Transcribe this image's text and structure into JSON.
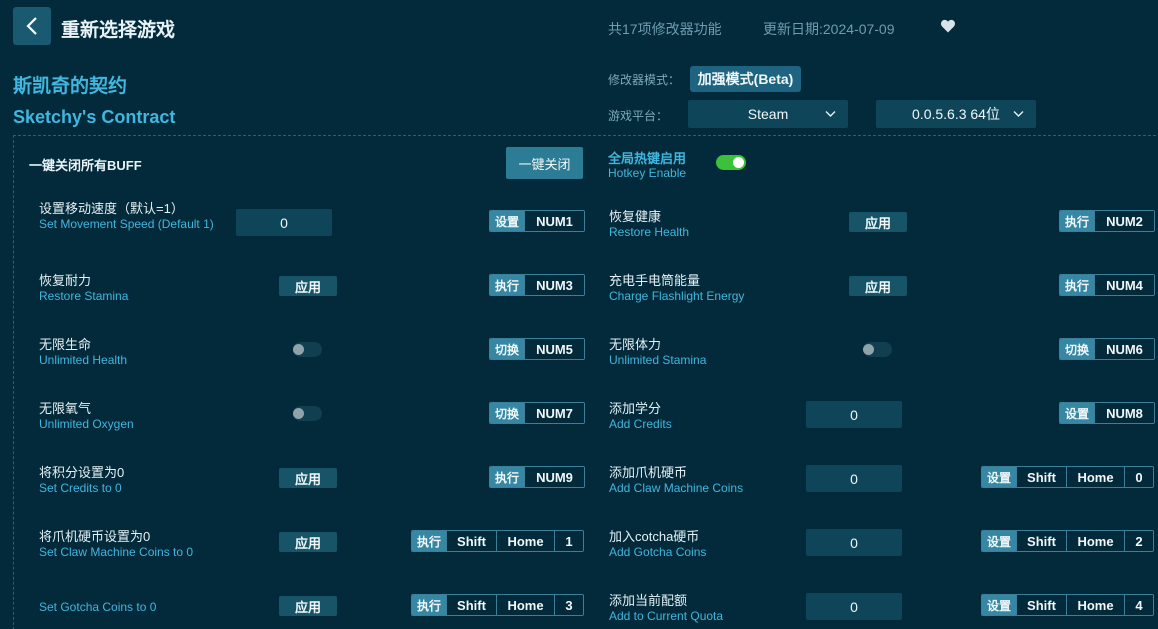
{
  "header": {
    "page_title": "重新选择游戏",
    "feature_count": "共17项修改器功能",
    "update_date": "更新日期:2024-07-09"
  },
  "game": {
    "name_cn": "斯凯奇的契约",
    "name_en": "Sketchy's Contract"
  },
  "mode": {
    "label": "修改器模式：",
    "value": "加强模式(Beta)"
  },
  "platform": {
    "label": "游戏平台：",
    "value": "Steam",
    "version": "0.0.5.6.3 64位"
  },
  "buff": {
    "label": "一键关闭所有BUFF",
    "close_all": "一键关闭"
  },
  "hotkey": {
    "label_cn": "全局热键启用",
    "label_en": "Hotkey Enable",
    "enabled": true
  },
  "options": [
    {
      "cn": "设置移动速度（默认=1）",
      "en": "Set Movement Speed (Default 1)",
      "value": "0",
      "action": "设置",
      "keys": [
        "NUM1"
      ]
    },
    {
      "cn": "恢复健康",
      "en": "Restore Health",
      "button": "应用",
      "action": "执行",
      "keys": [
        "NUM2"
      ]
    },
    {
      "cn": "恢复耐力",
      "en": "Restore Stamina",
      "button": "应用",
      "action": "执行",
      "keys": [
        "NUM3"
      ]
    },
    {
      "cn": "充电手电筒能量",
      "en": "Charge Flashlight Energy",
      "button": "应用",
      "action": "执行",
      "keys": [
        "NUM4"
      ]
    },
    {
      "cn": "无限生命",
      "en": "Unlimited Health",
      "toggle": false,
      "action": "切换",
      "keys": [
        "NUM5"
      ]
    },
    {
      "cn": "无限体力",
      "en": "Unlimited Stamina",
      "toggle": false,
      "action": "切换",
      "keys": [
        "NUM6"
      ]
    },
    {
      "cn": "无限氧气",
      "en": "Unlimited Oxygen",
      "toggle": false,
      "action": "切换",
      "keys": [
        "NUM7"
      ]
    },
    {
      "cn": "添加学分",
      "en": "Add Credits",
      "value": "0",
      "action": "设置",
      "keys": [
        "NUM8"
      ]
    },
    {
      "cn": "将积分设置为0",
      "en": "Set Credits to 0",
      "button": "应用",
      "action": "执行",
      "keys": [
        "NUM9"
      ]
    },
    {
      "cn": "添加爪机硬币",
      "en": "Add Claw Machine Coins",
      "value": "0",
      "action": "设置",
      "keys": [
        "Shift",
        "Home",
        "0"
      ]
    },
    {
      "cn": "将爪机硬币设置为0",
      "en": "Set Claw Machine Coins to 0",
      "button": "应用",
      "action": "执行",
      "keys": [
        "Shift",
        "Home",
        "1"
      ]
    },
    {
      "cn": "加入cotcha硬币",
      "en": "Add Gotcha Coins",
      "value": "0",
      "action": "设置",
      "keys": [
        "Shift",
        "Home",
        "2"
      ]
    },
    {
      "cn": "",
      "en": "Set Gotcha Coins to 0",
      "button": "应用",
      "action": "执行",
      "keys": [
        "Shift",
        "Home",
        "3"
      ]
    },
    {
      "cn": "添加当前配额",
      "en": "Add to Current Quota",
      "value": "0",
      "action": "设置",
      "keys": [
        "Shift",
        "Home",
        "4"
      ]
    }
  ]
}
